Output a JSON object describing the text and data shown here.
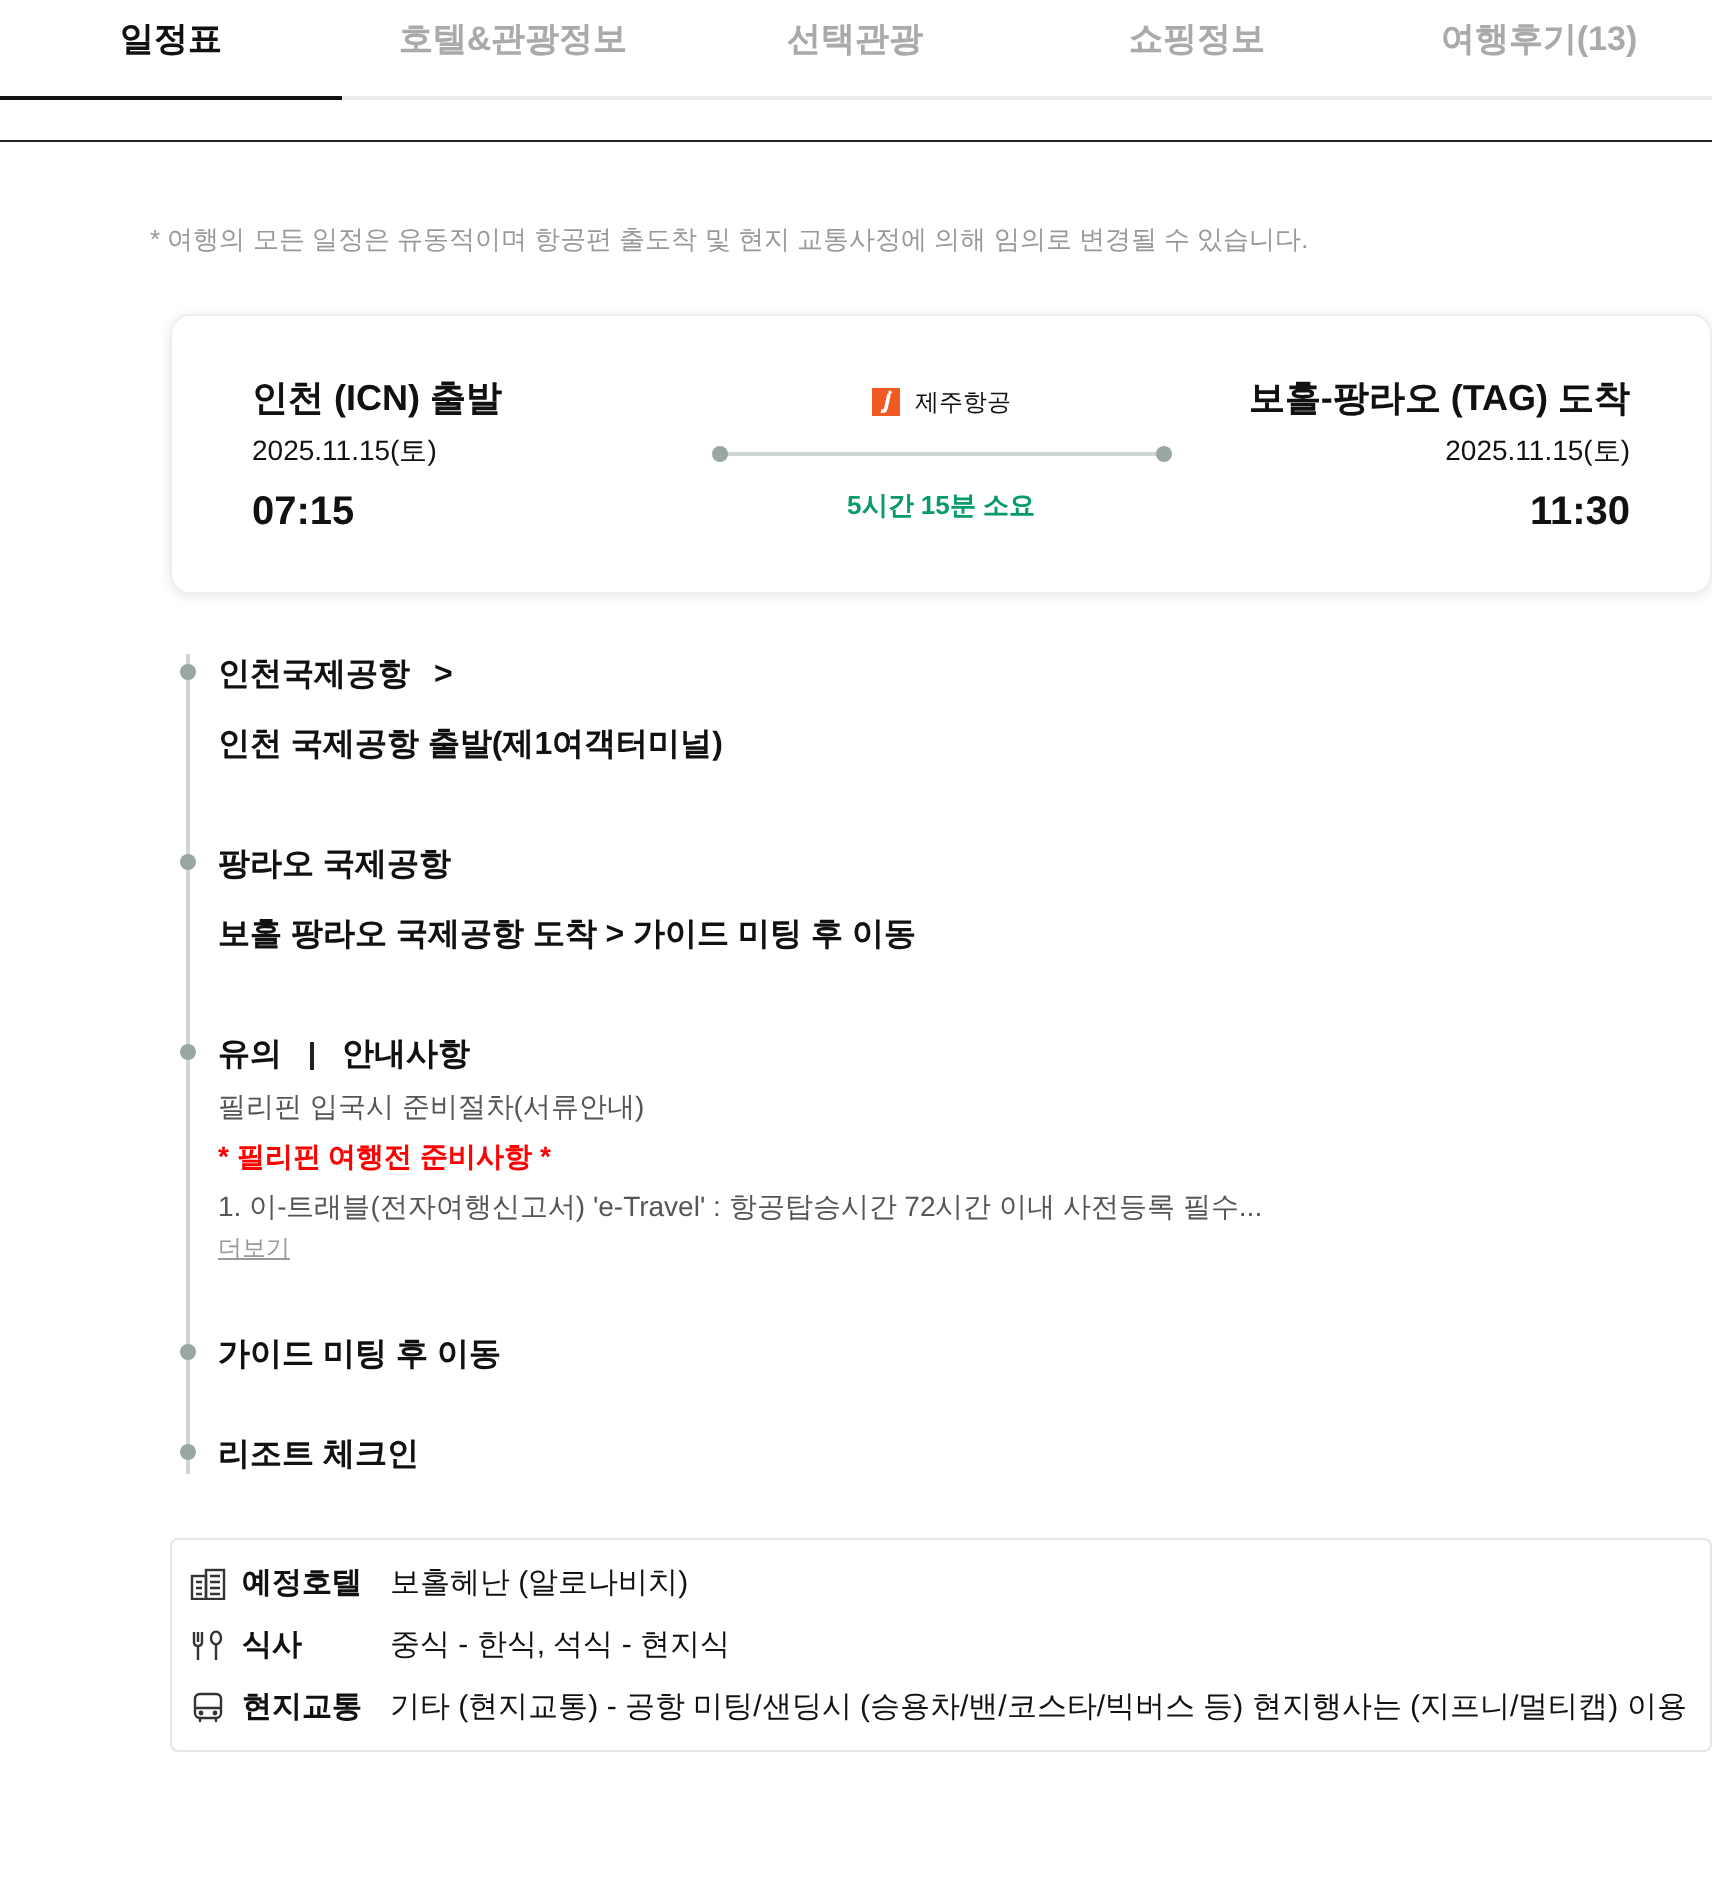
{
  "tabs": [
    {
      "label": "일정표",
      "selected": true
    },
    {
      "label": "호텔&관광정보",
      "selected": false
    },
    {
      "label": "선택관광",
      "selected": false
    },
    {
      "label": "쇼핑정보",
      "selected": false
    },
    {
      "label": "여행후기(13)",
      "selected": false
    }
  ],
  "notice": "* 여행의 모든 일정은 유동적이며 항공편 출도착 및 현지 교통사정에 의해 임의로 변경될 수 있습니다.",
  "flight": {
    "departure": {
      "place": "인천 (ICN) 출발",
      "date": "2025.11.15(토)",
      "time": "07:15"
    },
    "airline": "제주항공",
    "duration": "5시간 15분 소요",
    "arrival": {
      "place": "보홀-팡라오 (TAG) 도착",
      "date": "2025.11.15(토)",
      "time": "11:30"
    }
  },
  "timeline": [
    {
      "kind": "place",
      "title": "인천국제공항",
      "chevron": ">",
      "detail": "인천 국제공항 출발(제1여객터미널)"
    },
    {
      "kind": "place",
      "title": "팡라오 국제공항",
      "detail": "보홀 팡라오 국제공항 도착 > 가이드 미팅 후 이동"
    },
    {
      "kind": "notice",
      "title": "유의",
      "title_2": "안내사항",
      "subtitle": "필리핀 입국시 준비절차(서류안내)",
      "highlight": "* 필리핀 여행전 준비사항 *",
      "text": "1. 이-트래블(전자여행신고서) 'e-Travel' : 항공탑승시간 72시간 이내 사전등록 필수...",
      "more": "더보기"
    },
    {
      "kind": "step",
      "title": "가이드 미팅 후 이동"
    },
    {
      "kind": "step",
      "title": "리조트 체크인"
    }
  ],
  "info": [
    {
      "kind": "hotel",
      "label": "예정호텔",
      "value": "보홀헤난 (알로나비치)"
    },
    {
      "kind": "meal",
      "label": "식사",
      "value": "중식 - 한식, 석식 - 현지식"
    },
    {
      "kind": "transport",
      "label": "현지교통",
      "value": "기타 (현지교통) - 공항 미팅/샌딩시 (승용차/밴/코스타/빅버스 등) 현지행사는 (지프니/멀티캡) 이용"
    }
  ]
}
